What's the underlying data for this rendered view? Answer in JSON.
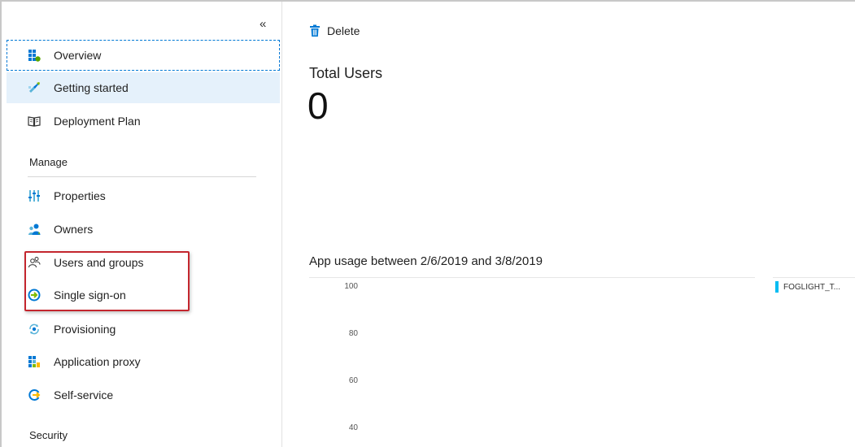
{
  "sidebar": {
    "collapse_glyph": "«",
    "items_top": [
      {
        "label": "Overview",
        "icon": "overview-icon"
      },
      {
        "label": "Getting started",
        "icon": "rocket-icon"
      },
      {
        "label": "Deployment Plan",
        "icon": "book-icon"
      }
    ],
    "manage_header": "Manage",
    "manage_items": [
      {
        "label": "Properties",
        "icon": "properties-icon"
      },
      {
        "label": "Owners",
        "icon": "owners-icon"
      },
      {
        "label": "Users and groups",
        "icon": "users-groups-icon"
      },
      {
        "label": "Single sign-on",
        "icon": "sso-icon"
      },
      {
        "label": "Provisioning",
        "icon": "provisioning-icon"
      },
      {
        "label": "Application proxy",
        "icon": "app-proxy-icon"
      },
      {
        "label": "Self-service",
        "icon": "self-service-icon"
      }
    ],
    "security_header": "Security"
  },
  "toolbar": {
    "delete_label": "Delete",
    "delete_icon": "trash-icon"
  },
  "summary": {
    "title": "Total Users",
    "value": "0"
  },
  "colors": {
    "accent": "#0078d4",
    "highlight": "#c4262e",
    "series": "#00bcf2",
    "selected_bg": "#e5f1fb"
  },
  "chart_data": {
    "type": "line",
    "title": "App usage between 2/6/2019 and 3/8/2019",
    "xlabel": "",
    "ylabel": "",
    "y_ticks": [
      "100",
      "80",
      "60",
      "40"
    ],
    "ylim": [
      40,
      100
    ],
    "grid": false,
    "legend_position": "right",
    "series": [
      {
        "name": "FOGLIGHT_T...",
        "values": []
      }
    ]
  }
}
